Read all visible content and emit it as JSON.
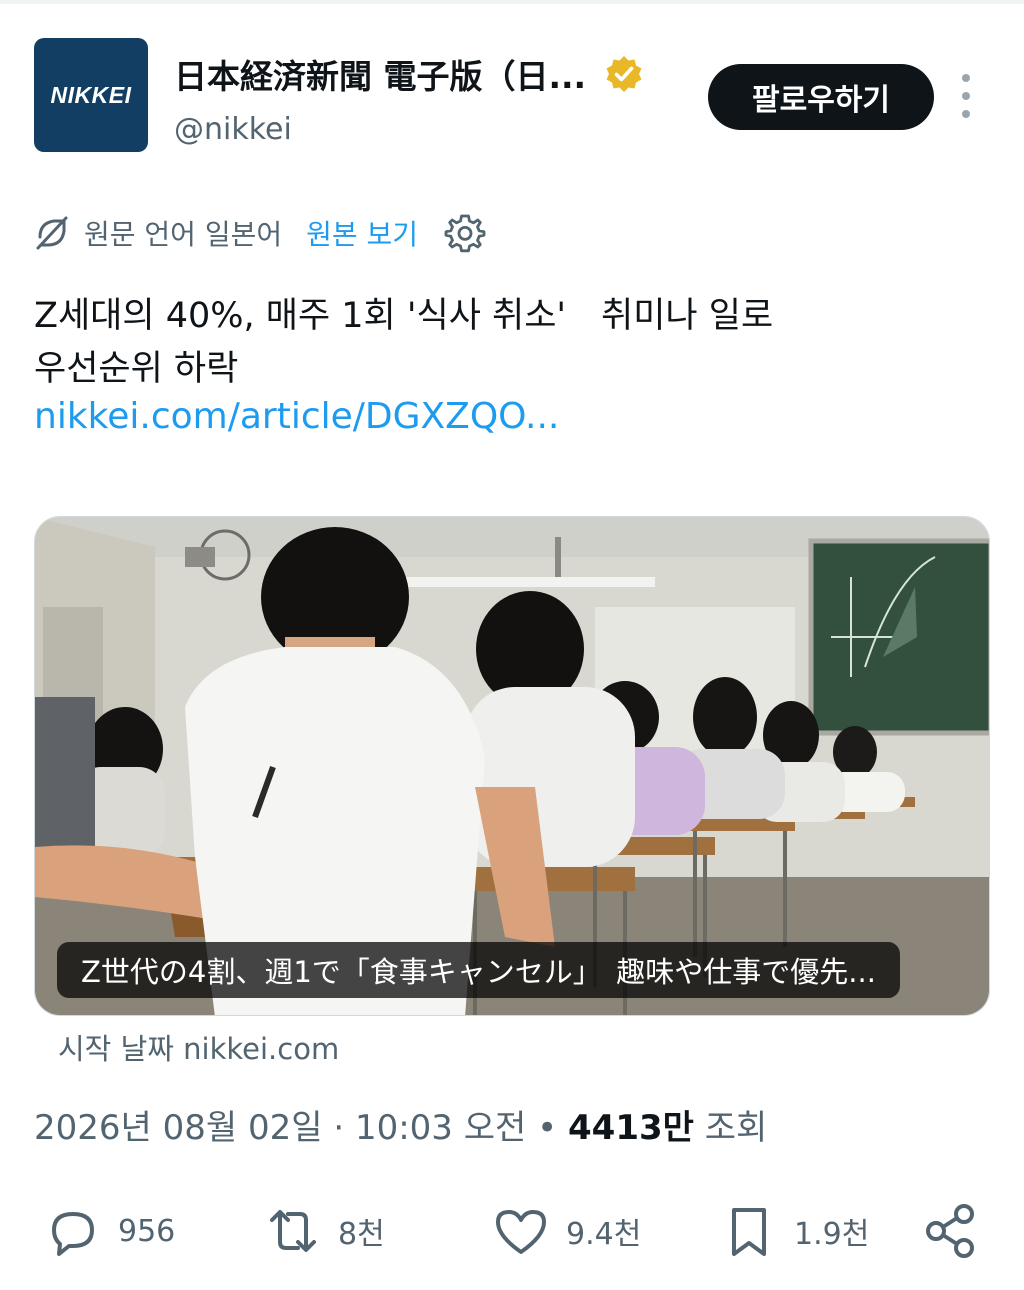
{
  "account": {
    "avatar_text": "NIKKEI",
    "display_name": "日本経済新聞 電子版（日...",
    "handle": "@nikkei",
    "verified_color": "#e8b829",
    "follow_label": "팔로우하기"
  },
  "translation": {
    "source_language": "원문 언어 일본어",
    "show_original": "원본 보기"
  },
  "tweet": {
    "text_line1": "Z세대의 40%, 매주 1회 '식사 취소'　취미나 일로",
    "text_line2": "우선순위 하락",
    "link": "nikkei.com/article/DGXZQO..."
  },
  "card": {
    "caption": "Z世代の4割、週1で「食事キャンセル」　趣味や仕事で優先...",
    "source": "시작 날짜 nikkei.com"
  },
  "meta": {
    "date": "2026년 08월 02일",
    "time": "10:03 오전",
    "views_count": "4413만",
    "views_label": "조회"
  },
  "actions": {
    "replies": "956",
    "retweets": "8천",
    "likes": "9.4천",
    "bookmarks": "1.9천"
  },
  "colors": {
    "link": "#1d9bf0",
    "secondary_text": "#536471",
    "brand_navy": "#123e63"
  }
}
